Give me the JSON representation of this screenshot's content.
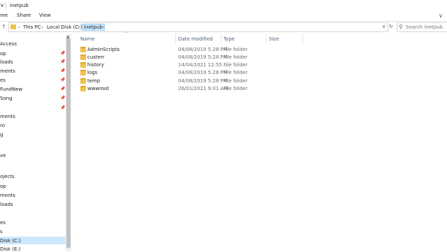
{
  "window": {
    "title": "inetpub",
    "collapse_icon": "chevron-down-icon"
  },
  "ribbon": {
    "tabs": [
      "me",
      "Share",
      "View"
    ]
  },
  "address": {
    "crumbs": [
      "This PC",
      "Local Disk (C:)",
      "inetpub"
    ],
    "search_placeholder": "Search inetpub"
  },
  "nav": {
    "items": [
      {
        "label": "Access",
        "pinned": false
      },
      {
        "label": "op",
        "pinned": true
      },
      {
        "label": "loads",
        "pinned": true
      },
      {
        "label": "ments",
        "pinned": true
      },
      {
        "label": "es",
        "pinned": true
      },
      {
        "label": "FundNew",
        "pinned": true
      },
      {
        "label": "Song",
        "pinned": true
      },
      {
        "label": "",
        "pinned": true
      },
      {
        "label": "ments",
        "pinned": false
      },
      {
        "label": "ro",
        "pinned": false
      },
      {
        "label": "g",
        "pinned": false
      },
      {
        "label": "ve",
        "pinned": false
      },
      {
        "label": "ojects",
        "pinned": false
      },
      {
        "label": "op",
        "pinned": false
      },
      {
        "label": "ments",
        "pinned": false
      },
      {
        "label": "loads",
        "pinned": false
      },
      {
        "label": "es",
        "pinned": false
      },
      {
        "label": "s",
        "pinned": false
      },
      {
        "label": "Disk (C:)",
        "pinned": false,
        "selected": true
      },
      {
        "label": "Disk (E:)",
        "pinned": false
      }
    ]
  },
  "columns": {
    "name": "Name",
    "date": "Date modified",
    "type": "Type",
    "size": "Size"
  },
  "files": [
    {
      "name": "AdminScripts",
      "date": "04/08/2019 5:28 PM",
      "type": "File folder"
    },
    {
      "name": "custerr",
      "date": "04/08/2019 5:28 PM",
      "type": "File folder"
    },
    {
      "name": "history",
      "date": "14/04/2021 12:55 ...",
      "type": "File folder"
    },
    {
      "name": "logs",
      "date": "04/08/2019 5:28 PM",
      "type": "File folder"
    },
    {
      "name": "temp",
      "date": "04/08/2019 5:28 PM",
      "type": "File folder"
    },
    {
      "name": "wwwroot",
      "date": "26/01/2021 9:01 AM",
      "type": "File folder"
    }
  ],
  "colors": {
    "selection": "#cce8ff",
    "folder": "#f0c247",
    "header_text": "#4c607a"
  }
}
